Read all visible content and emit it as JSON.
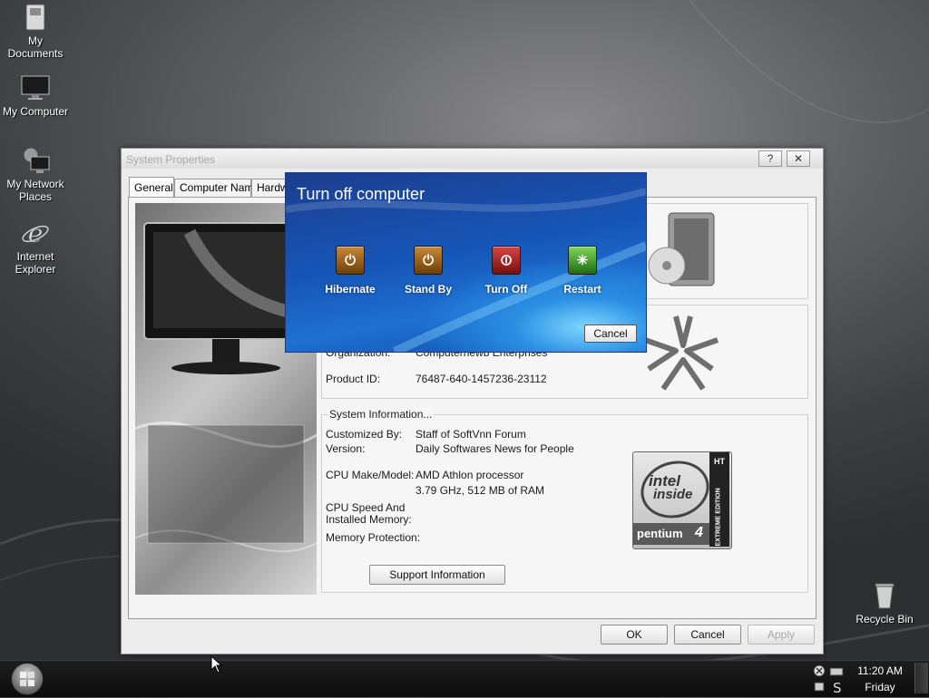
{
  "desktop": {
    "icons": [
      {
        "name": "my-documents",
        "label": "My Documents",
        "icon": "documents-icon"
      },
      {
        "name": "my-computer",
        "label": "My Computer",
        "icon": "computer-icon"
      },
      {
        "name": "my-network-places",
        "label": "My Network Places",
        "icon": "network-icon"
      },
      {
        "name": "internet-explorer",
        "label": "Internet Explorer",
        "icon": "ie-icon"
      },
      {
        "name": "recycle-bin",
        "label": "Recycle Bin",
        "icon": "recycle-bin-icon"
      }
    ]
  },
  "system_properties": {
    "title": "System Properties",
    "help_glyph": "?",
    "close_glyph": "✕",
    "tabs": [
      {
        "label": "General",
        "active": true
      },
      {
        "label": "Computer Name",
        "active": false
      },
      {
        "label": "Hardw",
        "active": false
      }
    ],
    "registered": {
      "organization_label": "Organization:",
      "organization_value": "Computernewb Enterprises",
      "product_id_label": "Product ID:",
      "product_id_value": "76487-640-1457236-23112"
    },
    "system_info": {
      "title": "System Information...",
      "customized_by_label": "Customized By:",
      "customized_by_value": "Staff of SoftVnn Forum",
      "version_label": "Version:",
      "version_value": "Daily Softwares News for People",
      "cpu_label": "CPU Make/Model:",
      "cpu_value": "AMD Athlon processor",
      "cpu_speed_value": "3.79 GHz, 512 MB of RAM",
      "speed_label_line1": "CPU Speed And",
      "speed_label_line2": "Installed Memory:",
      "memory_protection_label": "Memory Protection:",
      "support_button": "Support Information"
    },
    "intel_badge": {
      "intel": "intel",
      "inside": "inside",
      "pentium": "pentium",
      "four": "4",
      "ht": "HT",
      "extreme_edition": "EXTREME EDITION"
    },
    "buttons": {
      "ok": "OK",
      "cancel": "Cancel",
      "apply": "Apply"
    }
  },
  "turn_off_dialog": {
    "title": "Turn off computer",
    "options": [
      {
        "label": "Hibernate",
        "color": "#8a5a14"
      },
      {
        "label": "Stand By",
        "color": "#8a5a14"
      },
      {
        "label": "Turn Off",
        "color": "#9a1f1f"
      },
      {
        "label": "Restart",
        "color": "#2f8a1f"
      }
    ],
    "cancel": "Cancel"
  },
  "taskbar": {
    "time": "11:20 AM",
    "day": "Friday"
  }
}
